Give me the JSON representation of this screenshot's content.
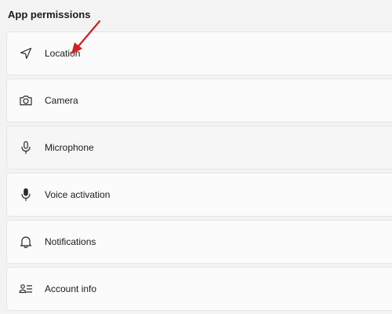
{
  "section": {
    "title": "App permissions"
  },
  "items": [
    {
      "label": "Location",
      "icon": "location-icon"
    },
    {
      "label": "Camera",
      "icon": "camera-icon"
    },
    {
      "label": "Microphone",
      "icon": "microphone-icon"
    },
    {
      "label": "Voice activation",
      "icon": "voice-activation-icon"
    },
    {
      "label": "Notifications",
      "icon": "bell-icon"
    },
    {
      "label": "Account info",
      "icon": "account-info-icon"
    }
  ],
  "colors": {
    "annotation_arrow": "#d41e1e"
  }
}
